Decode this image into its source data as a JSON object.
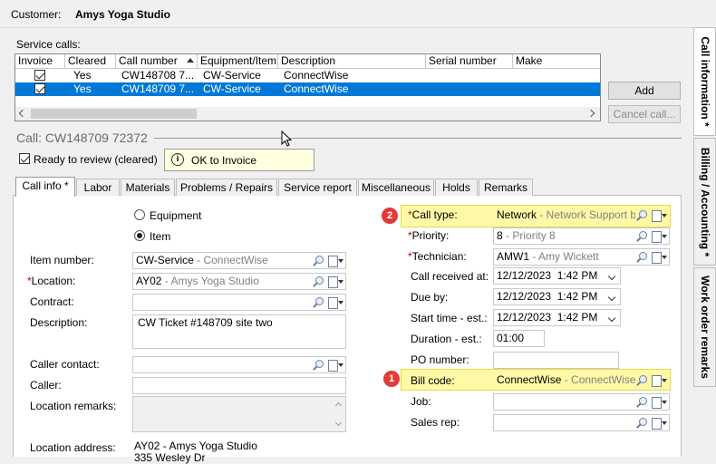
{
  "header": {
    "customer_label": "Customer:",
    "customer_name": "Amys Yoga Studio"
  },
  "service_calls": {
    "label": "Service calls:",
    "columns": [
      "Invoice",
      "Cleared",
      "Call number",
      "Equipment/Item",
      "Description",
      "Serial number",
      "Make"
    ],
    "rows": [
      {
        "invoice": true,
        "cleared": "Yes",
        "call_number": "CW148708 7...",
        "equipment": "CW-Service",
        "description": "ConnectWise",
        "selected": false
      },
      {
        "invoice": true,
        "cleared": "Yes",
        "call_number": "CW148709 7...",
        "equipment": "CW-Service",
        "description": "ConnectWise",
        "selected": true
      }
    ],
    "add_button": "Add",
    "cancel_button": "Cancel call..."
  },
  "call": {
    "title": "Call: CW148709 72372",
    "ready_label": "Ready to review (cleared)",
    "ready_checked": true,
    "tooltip": "OK to Invoice"
  },
  "tabs": [
    "Call info *",
    "Labor",
    "Materials",
    "Problems / Repairs",
    "Service report",
    "Miscellaneous",
    "Holds",
    "Remarks"
  ],
  "side_tabs": [
    "Call information *",
    "Billing / Accounting *",
    "Work order remarks"
  ],
  "left_form": {
    "radio_equipment": "Equipment",
    "radio_item": "Item",
    "item_number_label": "Item number:",
    "item_number_value": "CW-Service",
    "item_number_desc": " - ConnectWise",
    "location_label": "Location:",
    "location_value": "AY02",
    "location_desc": " - Amys Yoga Studio",
    "contract_label": "Contract:",
    "description_label": "Description:",
    "description_value": "CW Ticket #148709 site two",
    "caller_contact_label": "Caller contact:",
    "caller_label": "Caller:",
    "location_remarks_label": "Location remarks:",
    "location_address_label": "Location address:",
    "address_line1": "AY02 - Amys Yoga Studio",
    "address_line2": "335 Wesley Dr"
  },
  "right_form": {
    "call_type_label": "Call type:",
    "call_type_value": "Network",
    "call_type_desc": " - Network Support by H",
    "priority_label": "Priority:",
    "priority_value": "8",
    "priority_desc": " - Priority 8",
    "technician_label": "Technician:",
    "technician_value": "AMW1",
    "technician_desc": " - Amy Wickett",
    "call_received_label": "Call received at:",
    "call_received_date": "12/12/2023",
    "call_received_time": "1:42 PM",
    "due_by_label": "Due by:",
    "due_by_date": "12/12/2023",
    "due_by_time": "1:42 PM",
    "start_time_label": "Start time - est.:",
    "start_time_date": "12/12/2023",
    "start_time_time": "1:42 PM",
    "duration_label": "Duration - est.:",
    "duration_value": "01:00",
    "po_label": "PO number:",
    "bill_code_label": "Bill code:",
    "bill_code_value": "ConnectWise",
    "bill_code_desc": " - ConnectWise billi",
    "job_label": "Job:",
    "sales_rep_label": "Sales rep:"
  },
  "badges": {
    "call_type": "2",
    "bill_code": "1"
  },
  "colors": {
    "selected_row": "#0078d7",
    "highlight": "#fff9a6",
    "badge": "#e03a3a",
    "required": "#c00000"
  }
}
